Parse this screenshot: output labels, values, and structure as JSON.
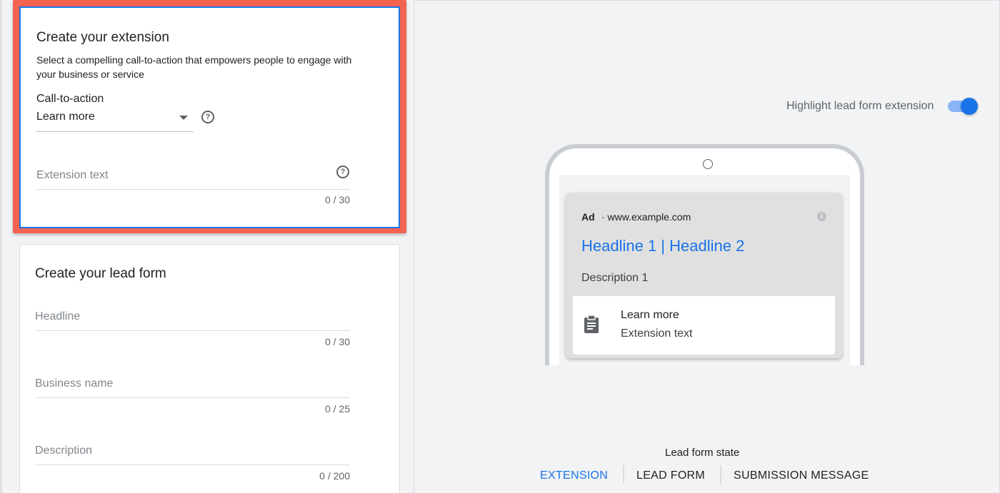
{
  "extension_card": {
    "title": "Create your extension",
    "description": "Select a compelling call-to-action that empowers people to engage with your business or service",
    "cta_label": "Call-to-action",
    "cta_value": "Learn more",
    "extension_text_placeholder": "Extension text",
    "extension_text_counter": "0 / 30"
  },
  "lead_form_card": {
    "title": "Create your lead form",
    "fields": [
      {
        "placeholder": "Headline",
        "counter": "0 / 30"
      },
      {
        "placeholder": "Business name",
        "counter": "0 / 25"
      },
      {
        "placeholder": "Description",
        "counter": "0 / 200"
      }
    ]
  },
  "preview": {
    "toggle_label": "Highlight lead form extension",
    "toggle_on": true,
    "ad_badge": "Ad",
    "ad_url": "· www.example.com",
    "headline": "Headline 1 | Headline 2",
    "description": "Description 1",
    "extension_cta": "Learn more",
    "extension_text": "Extension text",
    "info_icon": "i"
  },
  "lead_form_state": {
    "label": "Lead form state",
    "tabs": [
      "EXTENSION",
      "LEAD FORM",
      "SUBMISSION MESSAGE"
    ],
    "active_tab": "EXTENSION"
  },
  "colors": {
    "accent": "#1a73e8",
    "highlight": "#f26450"
  }
}
